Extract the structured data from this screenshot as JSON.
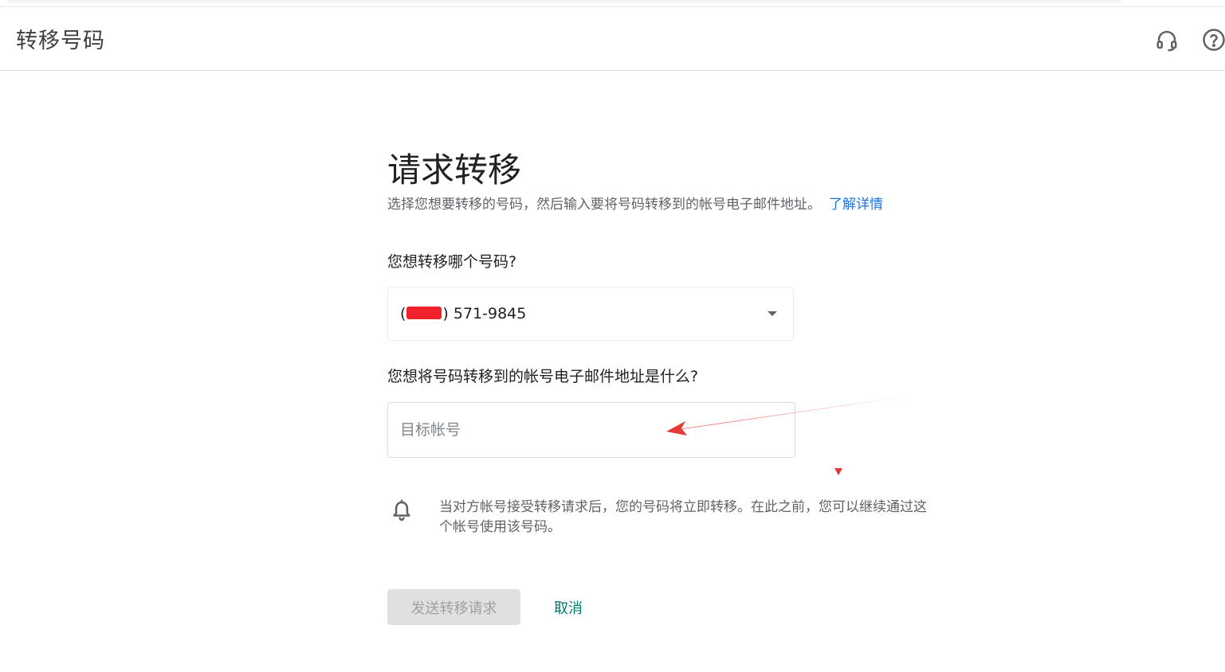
{
  "header": {
    "title": "转移号码",
    "support_icon": "headset-icon",
    "help_icon": "help-circle-icon"
  },
  "main": {
    "title": "请求转移",
    "subtitle": "选择您想要转移的号码，然后输入要将号码转移到的帐号电子邮件地址。",
    "learn_more": "了解详情",
    "number_question": "您想转移哪个号码?",
    "number_select": {
      "prefix": "(",
      "suffix": ") 571-9845"
    },
    "email_question": "您想将号码转移到的帐号电子邮件地址是什么?",
    "email_input": {
      "value": "",
      "placeholder": "目标帐号"
    },
    "notice": "当对方帐号接受转移请求后，您的号码将立即转移。在此之前，您可以继续通过这个帐号使用该号码。",
    "send_button": "发送转移请求",
    "cancel_button": "取消"
  },
  "colors": {
    "link": "#1a73e8",
    "cancel": "#00796b",
    "annotation": "#e53935",
    "redaction": "#f0212a"
  }
}
